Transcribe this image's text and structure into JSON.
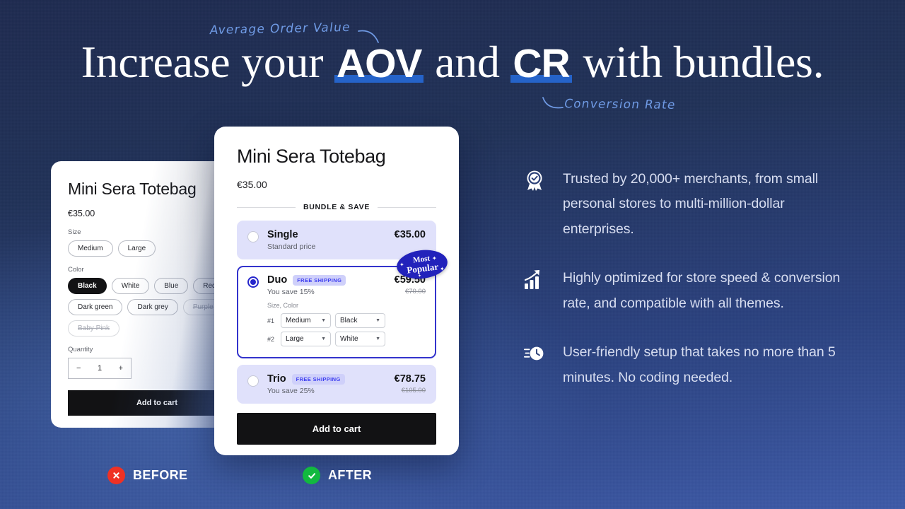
{
  "headline": {
    "part1": "Increase your ",
    "strong1": "AOV",
    "part2": " and ",
    "strong2": "CR",
    "part3": " with bundles."
  },
  "annotations": {
    "aov_note": "Average Order Value",
    "cr_note": "Conversion Rate"
  },
  "before_card": {
    "title": "Mini Sera Totebag",
    "price": "€35.00",
    "size_label": "Size",
    "sizes": [
      "Medium",
      "Large"
    ],
    "color_label": "Color",
    "colors": [
      {
        "label": "Black",
        "state": "selected"
      },
      {
        "label": "White",
        "state": "available"
      },
      {
        "label": "Blue",
        "state": "available"
      },
      {
        "label": "Red",
        "state": "available"
      },
      {
        "label": "Dark green",
        "state": "available"
      },
      {
        "label": "Dark grey",
        "state": "available"
      },
      {
        "label": "Purple",
        "state": "unavailable"
      },
      {
        "label": "Baby Pink",
        "state": "unavailable"
      }
    ],
    "quantity_label": "Quantity",
    "quantity_minus": "−",
    "quantity_value": "1",
    "quantity_plus": "+",
    "add_to_cart": "Add to cart"
  },
  "after_card": {
    "title": "Mini Sera Totebag",
    "price": "€35.00",
    "divider_label": "BUNDLE & SAVE",
    "add_to_cart": "Add to cart",
    "popular_badge": {
      "line1": "Most",
      "line2": "Popular"
    },
    "options": [
      {
        "name": "Single",
        "badge": "",
        "subtitle": "Standard price",
        "price": "€35.00",
        "old_price": "",
        "selected": false
      },
      {
        "name": "Duo",
        "badge": "FREE SHIPPING",
        "subtitle": "You save 15%",
        "price": "€59.50",
        "old_price": "€70.00",
        "selected": true,
        "variants_label": "Size, Color",
        "variants": [
          {
            "index": "#1",
            "size": "Medium",
            "color": "Black"
          },
          {
            "index": "#2",
            "size": "Large",
            "color": "White"
          }
        ]
      },
      {
        "name": "Trio",
        "badge": "FREE SHIPPING",
        "subtitle": "You save 25%",
        "price": "€78.75",
        "old_price": "€105.00",
        "selected": false
      }
    ]
  },
  "features": [
    {
      "icon": "award-badge-icon",
      "text": "Trusted by 20,000+ merchants, from small personal stores to multi-million-dollar enterprises."
    },
    {
      "icon": "growth-chart-icon",
      "text": "Highly optimized for store speed & conversion rate, and compatible with all themes."
    },
    {
      "icon": "fast-clock-icon",
      "text": "User-friendly setup that takes no more than 5 minutes. No coding needed."
    }
  ],
  "comparison_labels": {
    "before": "BEFORE",
    "after": "AFTER"
  },
  "colors": {
    "accent_blue": "#2563c9",
    "bundle_indigo": "#3333cc",
    "bundle_bg": "#e0e1fb",
    "bad": "#ef3124",
    "good": "#12b93f",
    "handwriting": "#6f9ae4"
  }
}
